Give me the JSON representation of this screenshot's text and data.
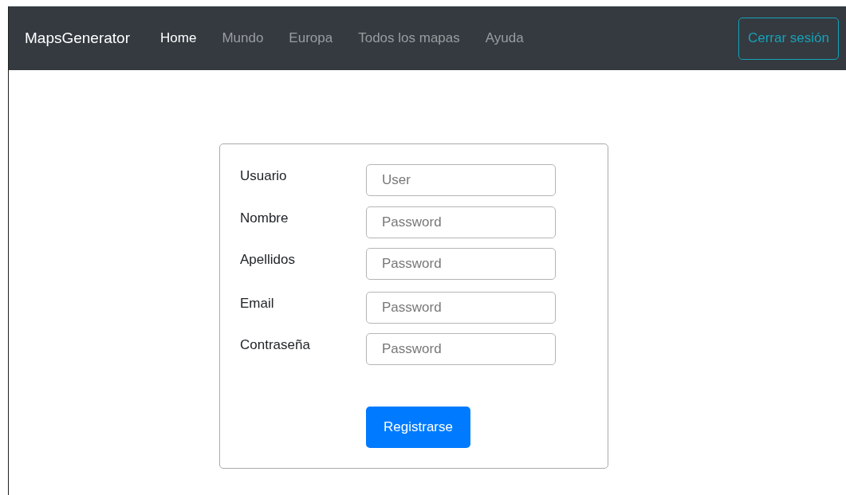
{
  "navbar": {
    "brand": "MapsGenerator",
    "links": [
      {
        "label": "Home",
        "selected": true
      },
      {
        "label": "Mundo",
        "selected": false
      },
      {
        "label": "Europa",
        "selected": false
      },
      {
        "label": "Todos los mapas",
        "selected": false
      },
      {
        "label": "Ayuda",
        "selected": false
      }
    ],
    "logout_button": "Cerrar sesión"
  },
  "form": {
    "fields": [
      {
        "label": "Usuario",
        "placeholder": "User"
      },
      {
        "label": "Nombre",
        "placeholder": "Password"
      },
      {
        "label": "Apellidos",
        "placeholder": "Password"
      },
      {
        "label": "Email",
        "placeholder": "Password"
      },
      {
        "label": "Contraseña",
        "placeholder": "Password"
      }
    ],
    "submit_button": "Registrarse"
  }
}
